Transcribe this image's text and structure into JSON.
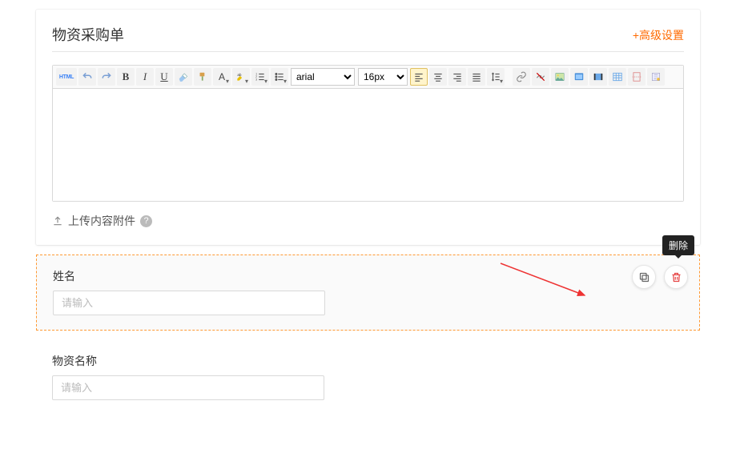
{
  "header": {
    "title": "物资采购单",
    "advanced_link": "+高级设置"
  },
  "toolbar": {
    "html": "HTML",
    "font_value": "arial",
    "size_value": "16px"
  },
  "attach": {
    "label": "上传内容附件",
    "help": "?"
  },
  "tooltip": {
    "delete": "删除"
  },
  "fields": [
    {
      "label": "姓名",
      "placeholder": "请输入"
    },
    {
      "label": "物资名称",
      "placeholder": "请输入"
    }
  ]
}
